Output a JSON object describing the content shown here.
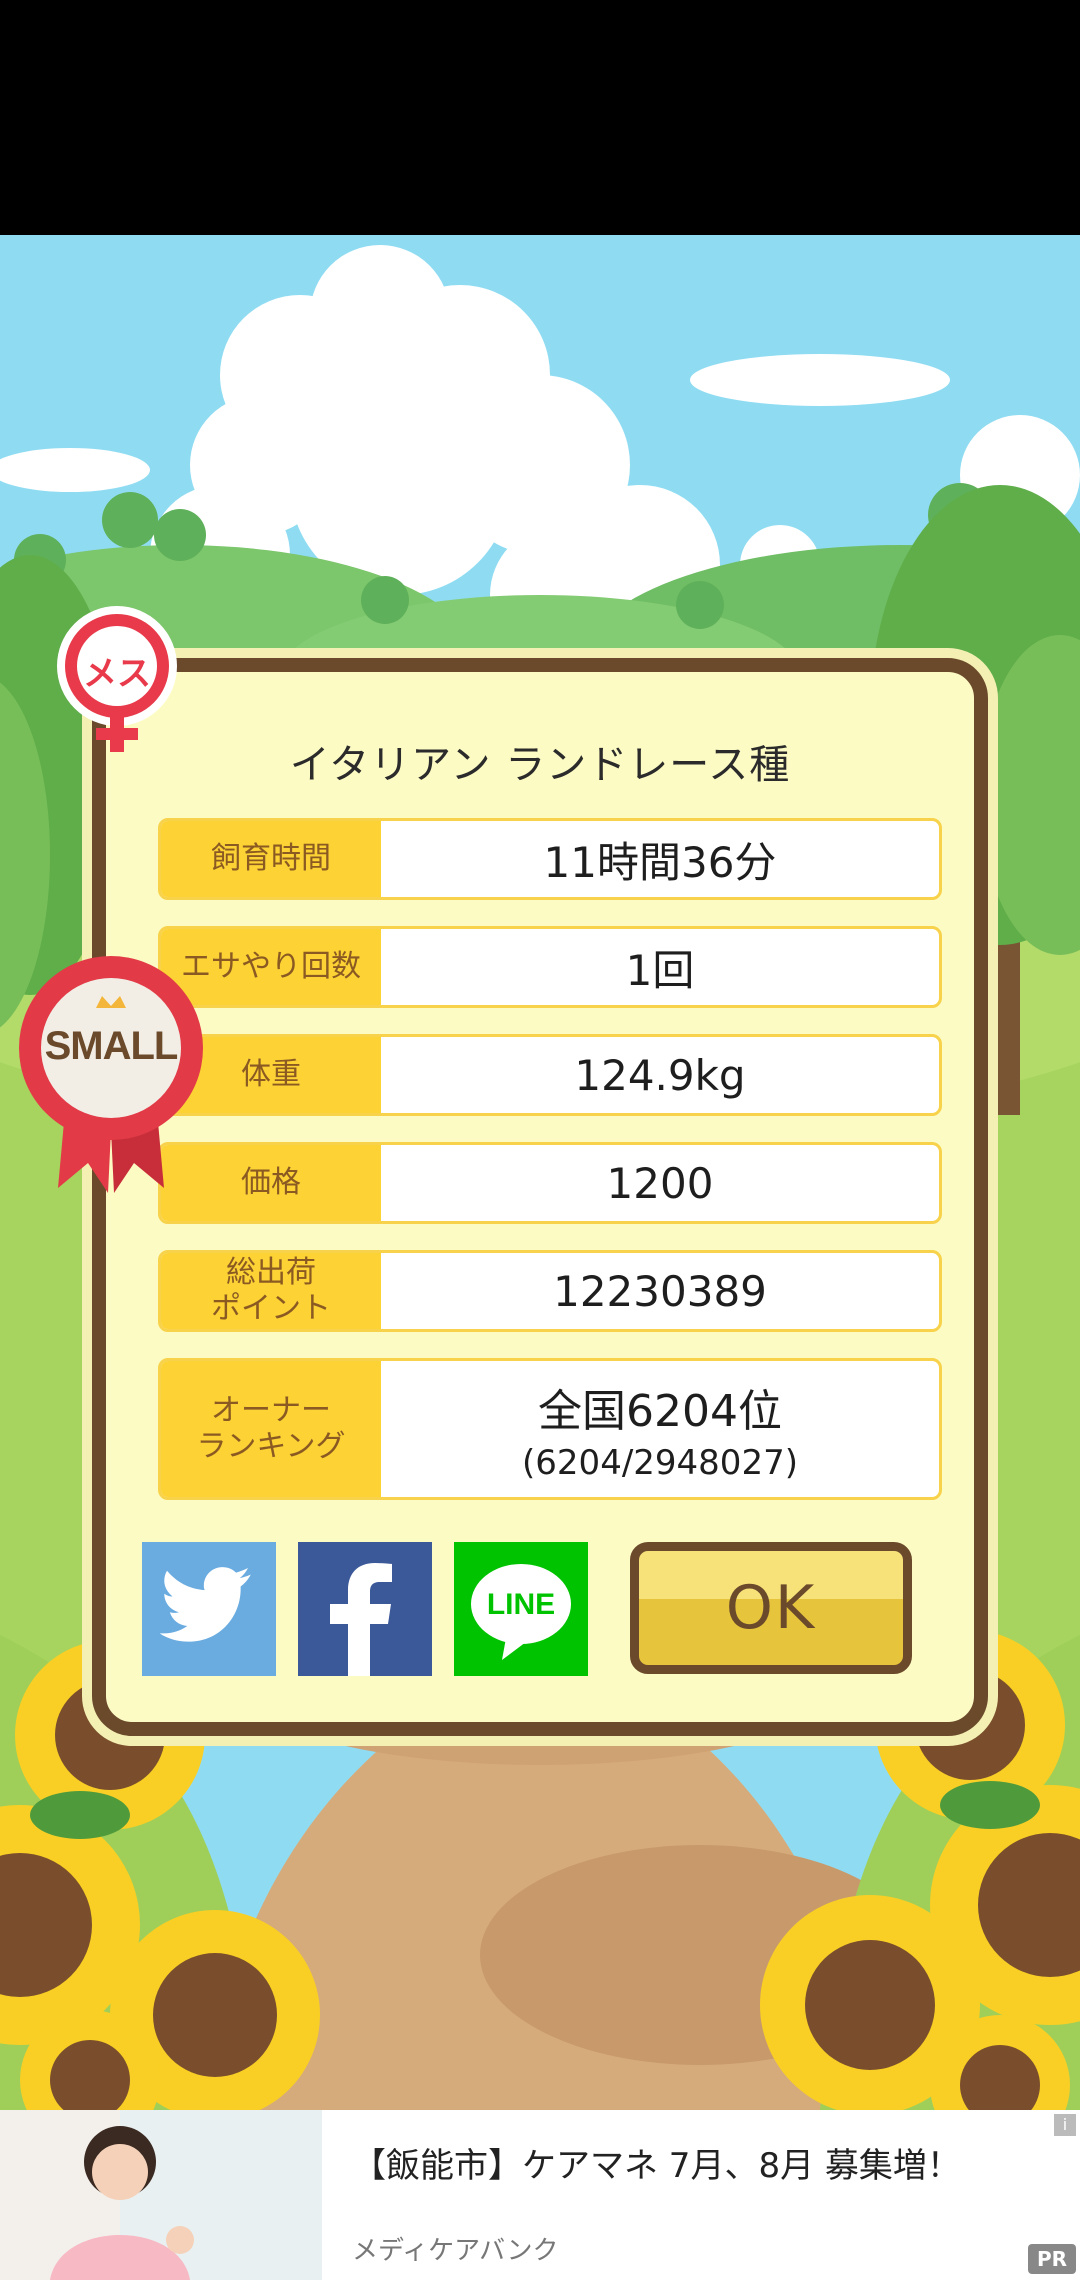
{
  "dialog": {
    "breed_title": "イタリアン ランドレース種",
    "rows": [
      {
        "label": "飼育時間",
        "value": "11時間36分"
      },
      {
        "label": "エサやり回数",
        "value": "1回"
      },
      {
        "label": "体重",
        "value": "124.9kg"
      },
      {
        "label": "価格",
        "value": "1200"
      },
      {
        "label": "総出荷\nポイント",
        "value": "12230389"
      }
    ],
    "ranking": {
      "label": "オーナー\nランキング",
      "value_main": "全国6204位",
      "value_sub": "(6204/2948027)"
    },
    "share": {
      "twitter_icon": "twitter-bird-icon",
      "facebook_icon": "facebook-f-icon",
      "line_label": "LINE"
    },
    "ok_label": "OK"
  },
  "badges": {
    "gender_label": "メス",
    "size_label": "SMALL"
  },
  "ad": {
    "title": "【飯能市】ケアマネ 7月、8月 募集増！",
    "advertiser": "メディケアバンク",
    "pr_label": "PR",
    "info_label": "i"
  },
  "colors": {
    "dialog_bg": "#fdfbc4",
    "dialog_border": "#6b4a2c",
    "label_bg": "#fcd235",
    "twitter": "#6aabe0",
    "facebook": "#3b5999",
    "line": "#00c300"
  }
}
